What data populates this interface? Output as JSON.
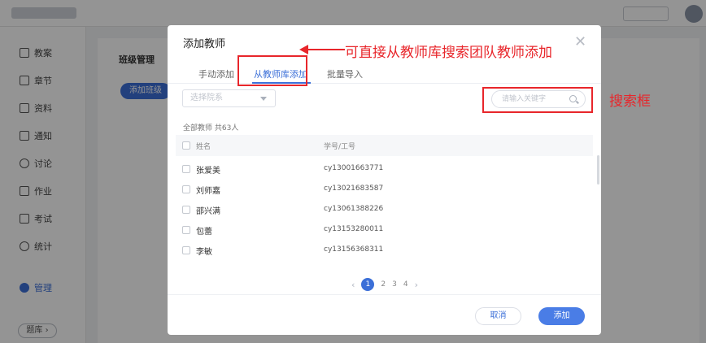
{
  "background": {
    "topbar_button": "",
    "sidebar": [
      {
        "label": "教案"
      },
      {
        "label": "章节"
      },
      {
        "label": "资料"
      },
      {
        "label": "通知"
      },
      {
        "label": "讨论"
      },
      {
        "label": "作业"
      },
      {
        "label": "考试"
      },
      {
        "label": "统计"
      },
      {
        "label": "管理"
      }
    ],
    "library_button": "题库 ›",
    "content_title": "班级管理",
    "content_button": "添加班级"
  },
  "modal": {
    "title": "添加教师",
    "close_icon": "close-icon",
    "tabs": [
      {
        "label": "手动添加",
        "active": false
      },
      {
        "label": "从教师库添加",
        "active": true
      },
      {
        "label": "批量导入",
        "active": false
      }
    ],
    "select_placeholder": "选择院系",
    "search_placeholder": "请输入关键字",
    "summary": "全部教师  共63人",
    "table_headers": {
      "name": "姓名",
      "id": "学号/工号"
    },
    "rows": [
      {
        "name": "张爱美",
        "id": "cy13001663771"
      },
      {
        "name": "刘师嘉",
        "id": "cy13021683587"
      },
      {
        "name": "邵兴满",
        "id": "cy13061388226"
      },
      {
        "name": "包蕾",
        "id": "cy13153280011"
      },
      {
        "name": "李敏",
        "id": "cy13156368311"
      }
    ],
    "pagination": {
      "pages": [
        "1",
        "2",
        "3",
        "4"
      ],
      "current": "1",
      "prev": "‹",
      "next": "›"
    },
    "cancel_label": "取消",
    "add_label": "添加"
  },
  "annotations": {
    "tab_note": "可直接从教师库搜索团队教师添加",
    "search_note": "搜索框",
    "color": "#e8262b"
  },
  "colors": {
    "accent": "#3b6fd8",
    "overlay": "rgba(0,0,0,0.42)"
  }
}
